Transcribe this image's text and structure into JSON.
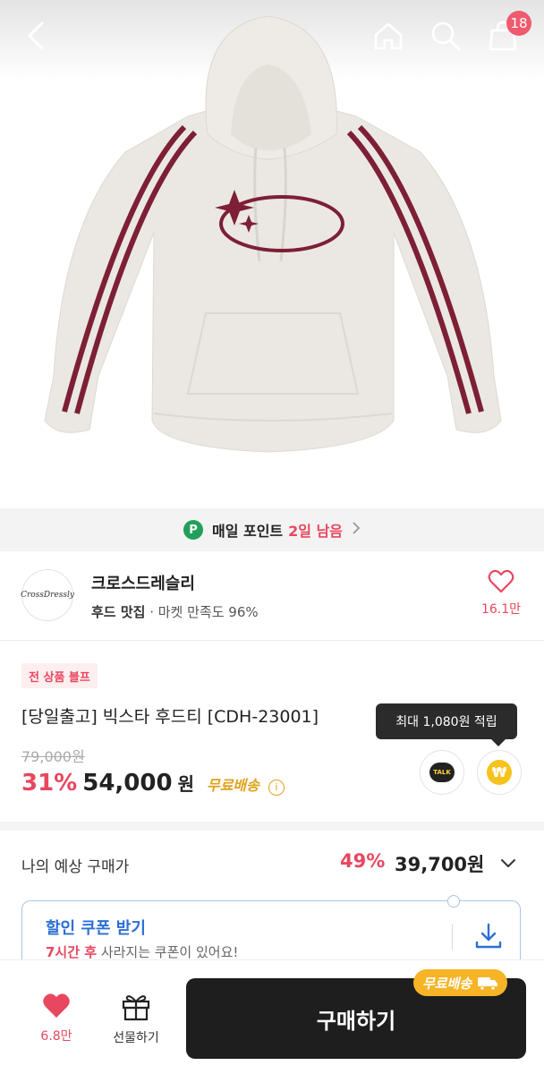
{
  "header": {
    "cart_count": "18"
  },
  "points_bar": {
    "badge": "P",
    "text": "매일 포인트",
    "days_left": "2일 남음"
  },
  "shop": {
    "logo_text": "CrossDressly",
    "name": "크로스드레슬리",
    "tag": "후드 맛집",
    "satisfaction": "· 마켓 만족도 96%",
    "likes": "16.1만"
  },
  "product": {
    "promo_tag": "전 상품 블프",
    "title": "[당일출고] 빅스타 후드티 [CDH-23001]",
    "original_price": "79,000원",
    "discount": "31%",
    "price": "54,000",
    "currency": "원",
    "free_shipping": "무료배송",
    "info_icon": "i"
  },
  "reward_tooltip": "최대 1,080원 적립",
  "talk_label": "TALK",
  "won_symbol": "₩",
  "expected_price": {
    "label": "나의 예상 구매가",
    "discount": "49%",
    "price": "39,700원"
  },
  "coupon": {
    "title": "할인 쿠폰 받기",
    "sub_highlight": "7시간 후",
    "sub_rest": " 사라지는 쿠폰이 있어요!"
  },
  "bottom_bar": {
    "likes": "6.8만",
    "gift_label": "선물하기",
    "buy_label": "구매하기",
    "ship_badge": "무료배송"
  },
  "colors": {
    "accent_red": "#e8475f",
    "coupon_blue": "#2b6fd6",
    "shipping_yellow": "#f6b426",
    "points_green": "#22a05a"
  }
}
